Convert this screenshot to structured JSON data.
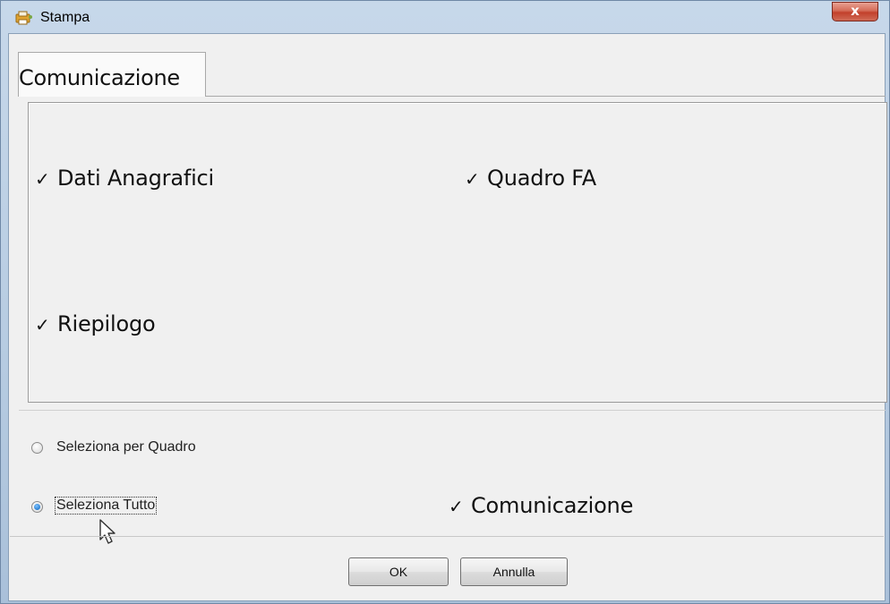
{
  "window": {
    "title": "Stampa",
    "close_label": "x"
  },
  "tabs": [
    {
      "label": "Comunicazione",
      "selected": true
    }
  ],
  "panel": {
    "checkboxes": [
      {
        "label": "Dati Anagrafici",
        "checked": true
      },
      {
        "label": "Quadro FA",
        "checked": true
      },
      {
        "label": "Riepilogo",
        "checked": true
      }
    ]
  },
  "selection": {
    "radio_per_quadro": {
      "label": "Seleziona per Quadro",
      "checked": false
    },
    "radio_tutto": {
      "label": "Seleziona Tutto",
      "checked": true
    },
    "comunicazione_check": {
      "label": "Comunicazione",
      "checked": true
    }
  },
  "buttons": {
    "ok": "OK",
    "cancel": "Annulla"
  },
  "colors": {
    "title_bar": "#b6cbe1",
    "close_button": "#c2402b",
    "radio_selected": "#1a72c9"
  }
}
